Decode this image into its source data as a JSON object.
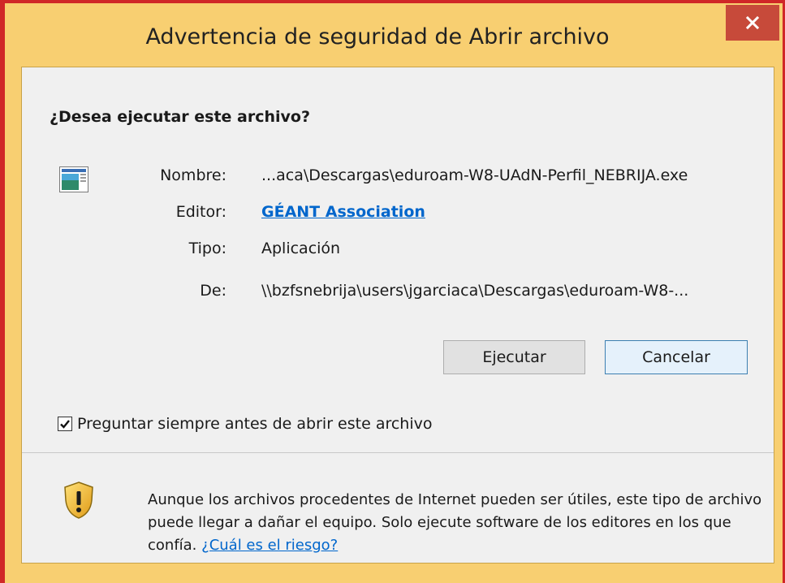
{
  "window": {
    "title": "Advertencia de seguridad de Abrir archivo",
    "close_glyph": "×"
  },
  "dialog": {
    "question": "¿Desea ejecutar este archivo?",
    "icon": "application-window-icon",
    "fields": {
      "name_label": "Nombre:",
      "name_value": "...aca\\Descargas\\eduroam-W8-UAdN-Perfil_NEBRIJA.exe",
      "publisher_label": "Editor:",
      "publisher_value": "GÉANT Association",
      "type_label": "Tipo:",
      "type_value": "Aplicación",
      "from_label": "De:",
      "from_value": "\\\\bzfsnebrija\\users\\jgarciaca\\Descargas\\eduroam-W8-..."
    },
    "buttons": {
      "run": "Ejecutar",
      "cancel": "Cancelar"
    },
    "checkbox": {
      "label": "Preguntar siempre antes de abrir este archivo",
      "checked": true
    }
  },
  "warning": {
    "icon": "shield-warning-icon",
    "text": "Aunque los archivos procedentes de Internet pueden ser útiles, este tipo de archivo puede llegar a dañar el equipo. Solo ejecute software de los editores en los que confía. ",
    "link": "¿Cuál es el riesgo?"
  },
  "colors": {
    "title_bar": "#f8cf71",
    "window_border": "#d02727",
    "close_button": "#c74a3a",
    "link": "#0066cc",
    "client_background": "#f0f0f0"
  }
}
